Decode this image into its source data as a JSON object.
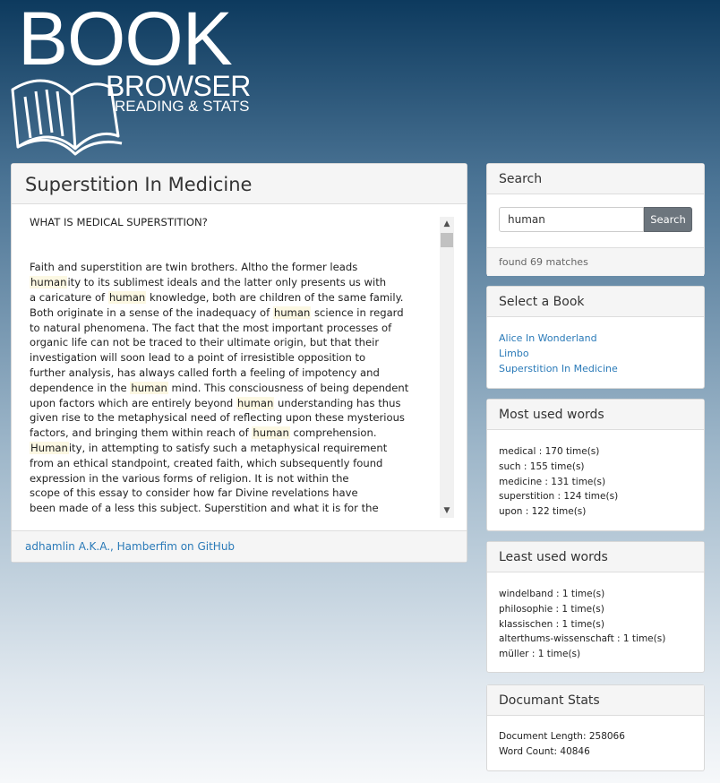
{
  "logo": {
    "big": "BOOK",
    "mid": "BROWSER",
    "small": "READING & STATS"
  },
  "book": {
    "title": "Superstition In Medicine",
    "lines": [
      [
        {
          "t": "WHAT IS MEDICAL SUPERSTITION?"
        }
      ],
      [
        {
          "t": ""
        }
      ],
      [
        {
          "t": ""
        }
      ],
      [
        {
          "t": "Faith and superstition are twin brothers. Altho the former leads"
        }
      ],
      [
        {
          "t": "human",
          "h": true
        },
        {
          "t": "ity to its sublimest ideals and the latter only presents us with"
        }
      ],
      [
        {
          "t": "a caricature of "
        },
        {
          "t": "human",
          "h": true
        },
        {
          "t": " knowledge, both are children of the same family."
        }
      ],
      [
        {
          "t": "Both originate in a sense of the inadequacy of "
        },
        {
          "t": "human",
          "h": true
        },
        {
          "t": " science in regard"
        }
      ],
      [
        {
          "t": "to natural phenomena. The fact that the most important processes of"
        }
      ],
      [
        {
          "t": "organic life can not be traced to their ultimate origin, but that their"
        }
      ],
      [
        {
          "t": "investigation will soon lead to a point of irresistible opposition to"
        }
      ],
      [
        {
          "t": "further analysis, has always called forth a feeling of impotency and"
        }
      ],
      [
        {
          "t": "dependence in the "
        },
        {
          "t": "human",
          "h": true
        },
        {
          "t": " mind. This consciousness of being dependent"
        }
      ],
      [
        {
          "t": "upon factors which are entirely beyond "
        },
        {
          "t": "human",
          "h": true
        },
        {
          "t": " understanding has thus"
        }
      ],
      [
        {
          "t": "given rise to the metaphysical need of reflecting upon these mysterious"
        }
      ],
      [
        {
          "t": "factors, and bringing them within reach of "
        },
        {
          "t": "human",
          "h": true
        },
        {
          "t": " comprehension."
        }
      ],
      [
        {
          "t": "Human",
          "h": true
        },
        {
          "t": "ity, in attempting to satisfy such a metaphysical requirement"
        }
      ],
      [
        {
          "t": "from an ethical standpoint, created faith, which subsequently found"
        }
      ],
      [
        {
          "t": "expression in the various forms of religion. It is not within the"
        }
      ],
      [
        {
          "t": "scope of this essay to consider how far Divine revelations have"
        }
      ],
      [
        {
          "t": "been made of a less this subject. Superstition and what it is for the"
        }
      ]
    ],
    "footer_link": "adhamlin A.K.A., Hamberfim on GitHub"
  },
  "search": {
    "title": "Search",
    "value": "human",
    "button": "Search",
    "result": "found 69 matches"
  },
  "select": {
    "title": "Select a Book",
    "books": [
      "Alice In Wonderland",
      "Limbo",
      "Superstition In Medicine"
    ]
  },
  "most_used": {
    "title": "Most used words",
    "items": [
      "medical : 170 time(s)",
      "such : 155 time(s)",
      "medicine : 131 time(s)",
      "superstition : 124 time(s)",
      "upon : 122 time(s)"
    ]
  },
  "least_used": {
    "title": "Least used words",
    "items": [
      "windelband : 1 time(s)",
      "philosophie : 1 time(s)",
      "klassischen : 1 time(s)",
      "alterthums-wissenschaft : 1 time(s)",
      "müller : 1 time(s)"
    ]
  },
  "stats": {
    "title": "Documant Stats",
    "length": "Document Length: 258066",
    "count": "Word Count: 40846"
  },
  "colors": {
    "link": "#2a7ab8",
    "highlight": "#fcf8e3",
    "button": "#6c757d"
  }
}
